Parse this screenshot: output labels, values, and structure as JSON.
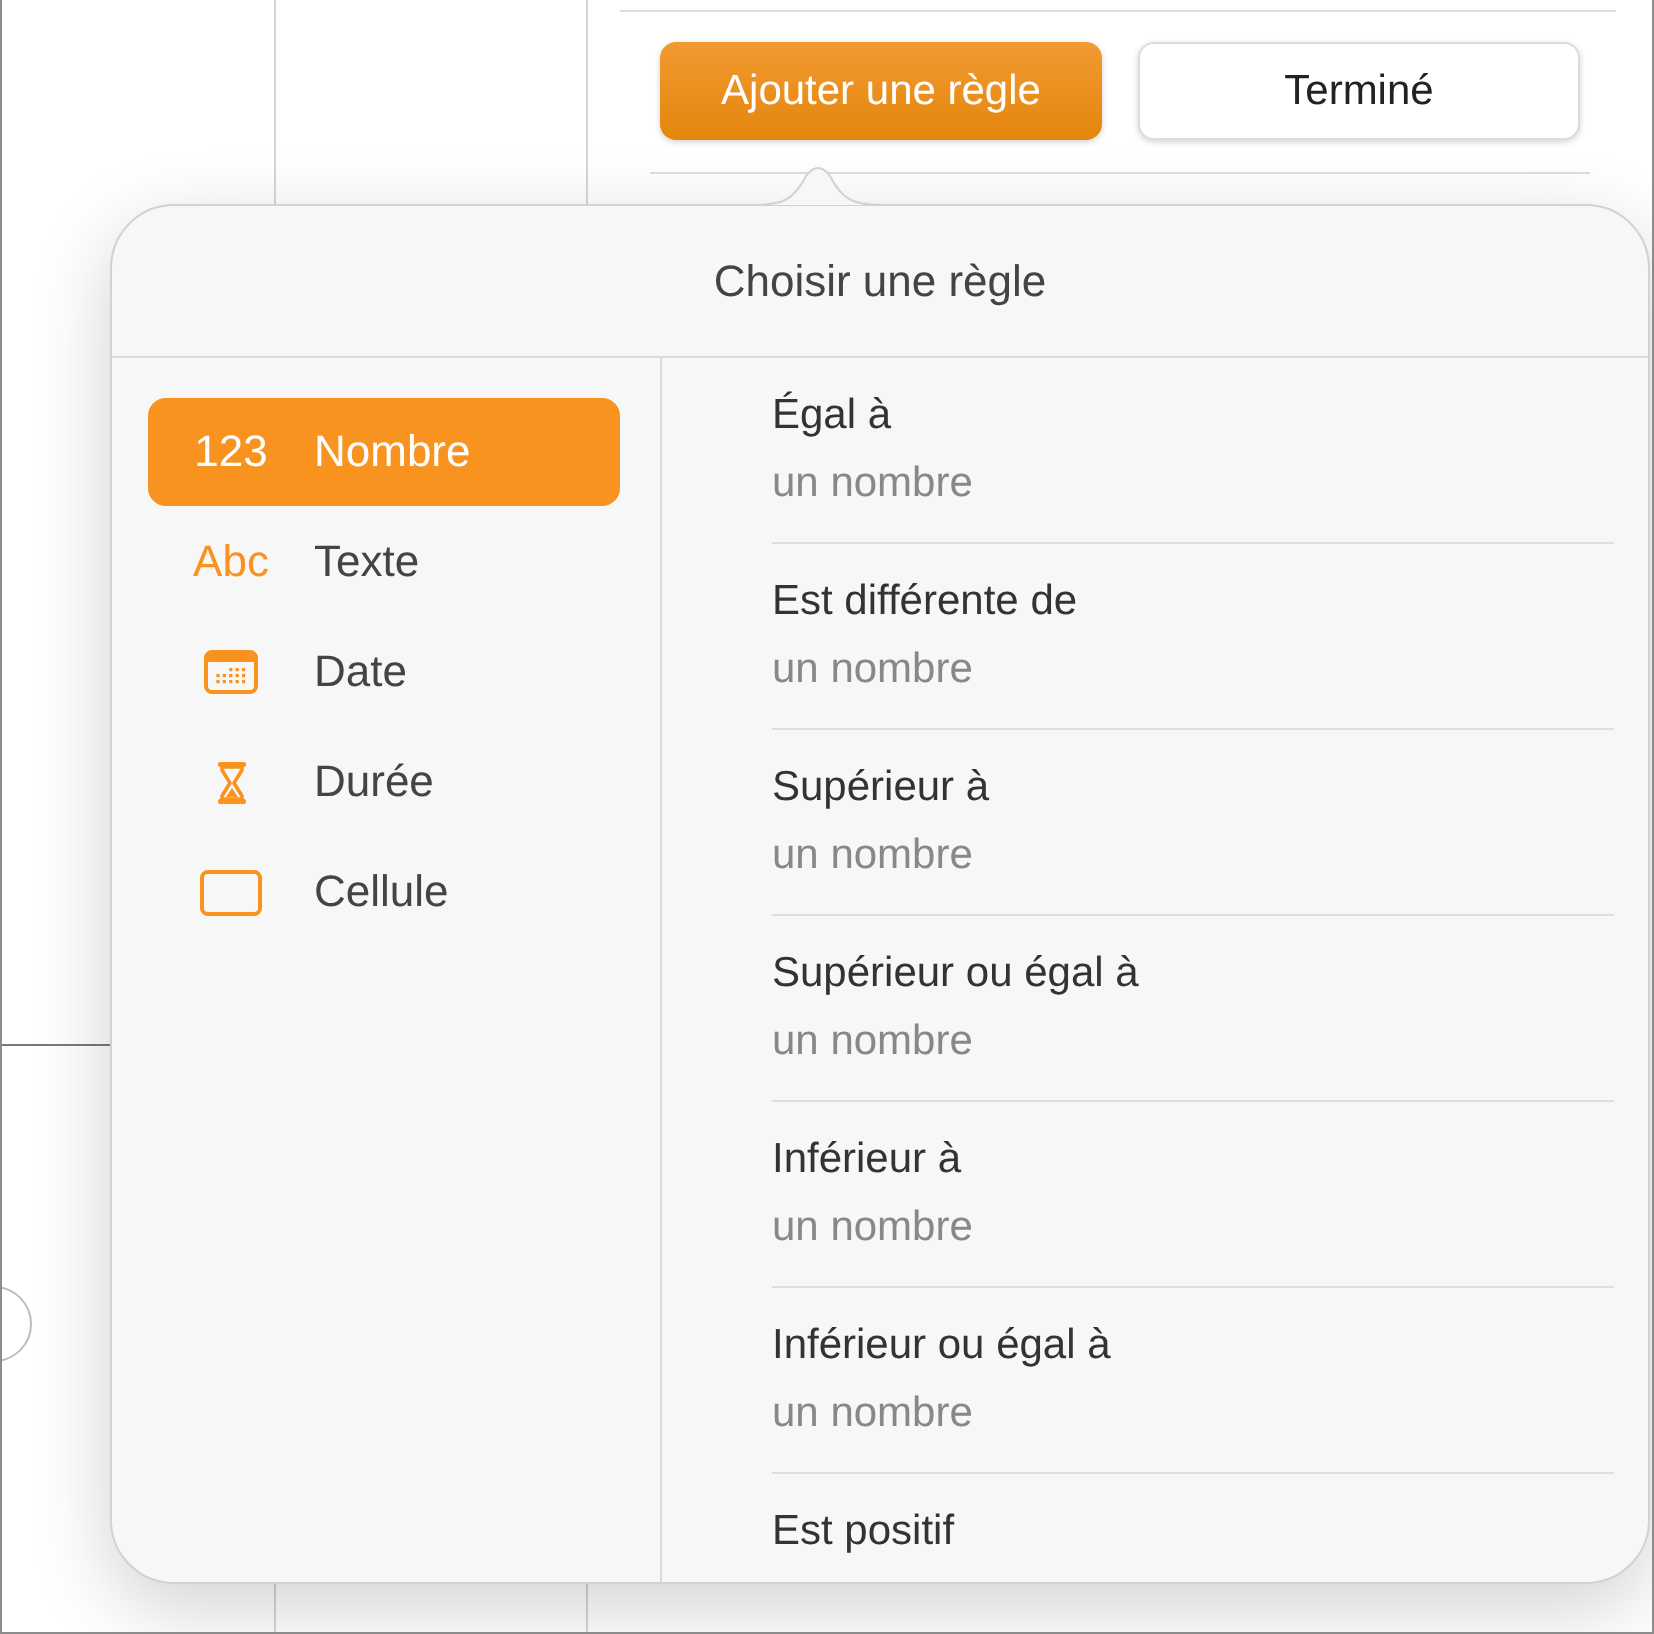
{
  "top_buttons": [
    {
      "label": "Ajouter une règle",
      "kind": "add"
    },
    {
      "label": "Terminé",
      "kind": "done"
    }
  ],
  "popover": {
    "title": "Choisir une règle",
    "categories": [
      {
        "label": "Nombre",
        "kind": "digits",
        "glyph": "123",
        "selected": true
      },
      {
        "label": "Texte",
        "kind": "letters",
        "glyph": "Abc",
        "selected": false
      },
      {
        "label": "Date",
        "kind": "calendar",
        "selected": false
      },
      {
        "label": "Durée",
        "kind": "hourglass",
        "selected": false
      },
      {
        "label": "Cellule",
        "kind": "rectangle",
        "selected": false
      }
    ],
    "rules": [
      {
        "title": "Égal à",
        "subtitle": "un nombre"
      },
      {
        "title": "Est différente de",
        "subtitle": "un nombre"
      },
      {
        "title": "Supérieur à",
        "subtitle": "un nombre"
      },
      {
        "title": "Supérieur ou égal à",
        "subtitle": "un nombre"
      },
      {
        "title": "Inférieur à",
        "subtitle": "un nombre"
      },
      {
        "title": "Inférieur ou égal à",
        "subtitle": "un nombre"
      },
      {
        "title": "Est positif"
      }
    ]
  }
}
